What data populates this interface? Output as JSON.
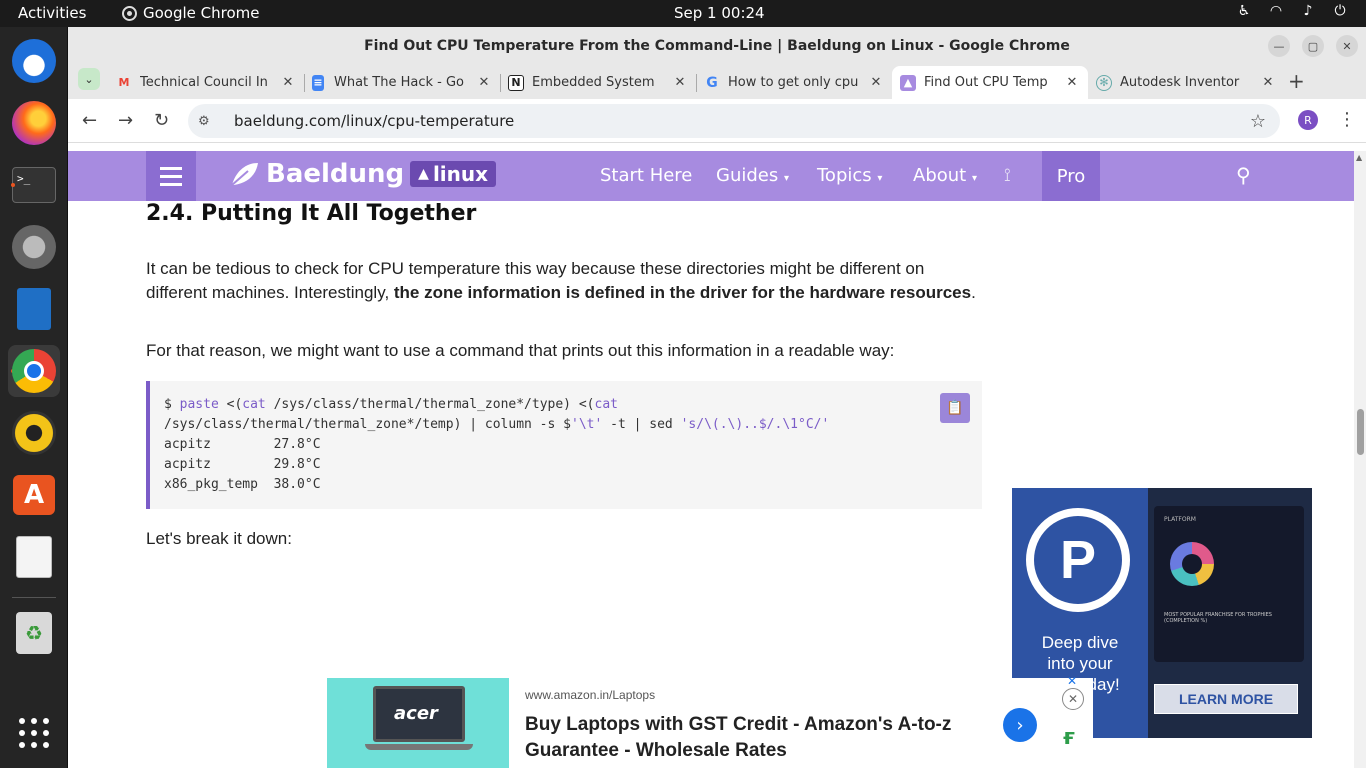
{
  "topbar": {
    "activities": "Activities",
    "app_name": "Google Chrome",
    "clock": "Sep 1  00:24"
  },
  "window": {
    "title": "Find Out CPU Temperature From the Command-Line | Baeldung on Linux - Google Chrome"
  },
  "tabs": [
    {
      "label": "Technical Council In",
      "favicon": "gmail-icon",
      "active": false
    },
    {
      "label": "What The Hack - Go",
      "favicon": "docs-icon",
      "active": false
    },
    {
      "label": "Embedded System",
      "favicon": "notion-icon",
      "active": false
    },
    {
      "label": "How to get only cpu",
      "favicon": "google-icon",
      "active": false
    },
    {
      "label": "Find Out CPU Temp",
      "favicon": "baeldung-icon",
      "active": true
    },
    {
      "label": "Autodesk Inventor",
      "favicon": "autodesk-icon",
      "active": false
    }
  ],
  "address_bar": {
    "url": "baeldung.com/linux/cpu-temperature",
    "profile_initial": "R"
  },
  "site_nav": {
    "logo_text": "Baeldung",
    "logo_badge": "linux",
    "items": [
      "Start Here",
      "Guides",
      "Topics",
      "About"
    ],
    "pro": "Pro"
  },
  "article": {
    "heading": "2.4. Putting It All Together",
    "para1_plain": "It can be tedious to check for CPU temperature this way because these directories might be different on different machines. Interestingly, ",
    "para1_bold": "the zone information is defined in the driver for the hardware resources",
    "para1_end": ".",
    "para2": "For that reason, we might want to use a command that prints out this information in a readable way:",
    "code": {
      "line1_a": "$ ",
      "line1_paste": "paste",
      "line1_b": " <(",
      "line1_cat": "cat",
      "line1_c": " /sys/class/thermal/thermal_zone*/type) <(",
      "line1_cat2": "cat",
      "line2_a": "/sys/class/thermal/thermal_zone*/temp) | column -s $",
      "line2_t": "'\\t'",
      "line2_b": " -t | sed ",
      "line2_sed": "'s/\\(.\\)..$/.\\1°C/'",
      "out": [
        "acpitz        27.8°C",
        "acpitz        29.8°C",
        "x86_pkg_temp  38.0°C"
      ]
    },
    "para3": "Let's break it down:"
  },
  "side_ad": {
    "logo_letter": "P",
    "tagline": "Deep dive into your ration day!",
    "panel_label": "PLATFORM",
    "panel_sub": "MOST POPULAR FRANCHISE FOR TROPHIES (COMPLETION %)",
    "cta": "LEARN MORE"
  },
  "bottom_ad": {
    "brand_on_image": "acer",
    "url": "www.amazon.in/Laptops",
    "headline": "Buy Laptops with GST Credit - Amazon's A-to-z Guarantee - Wholesale Rates"
  },
  "colors": {
    "nav_purple": "#a78be0",
    "nav_dark": "#8b6dd1",
    "code_accent": "#7b5cc8",
    "ubuntu_orange": "#e95420"
  }
}
